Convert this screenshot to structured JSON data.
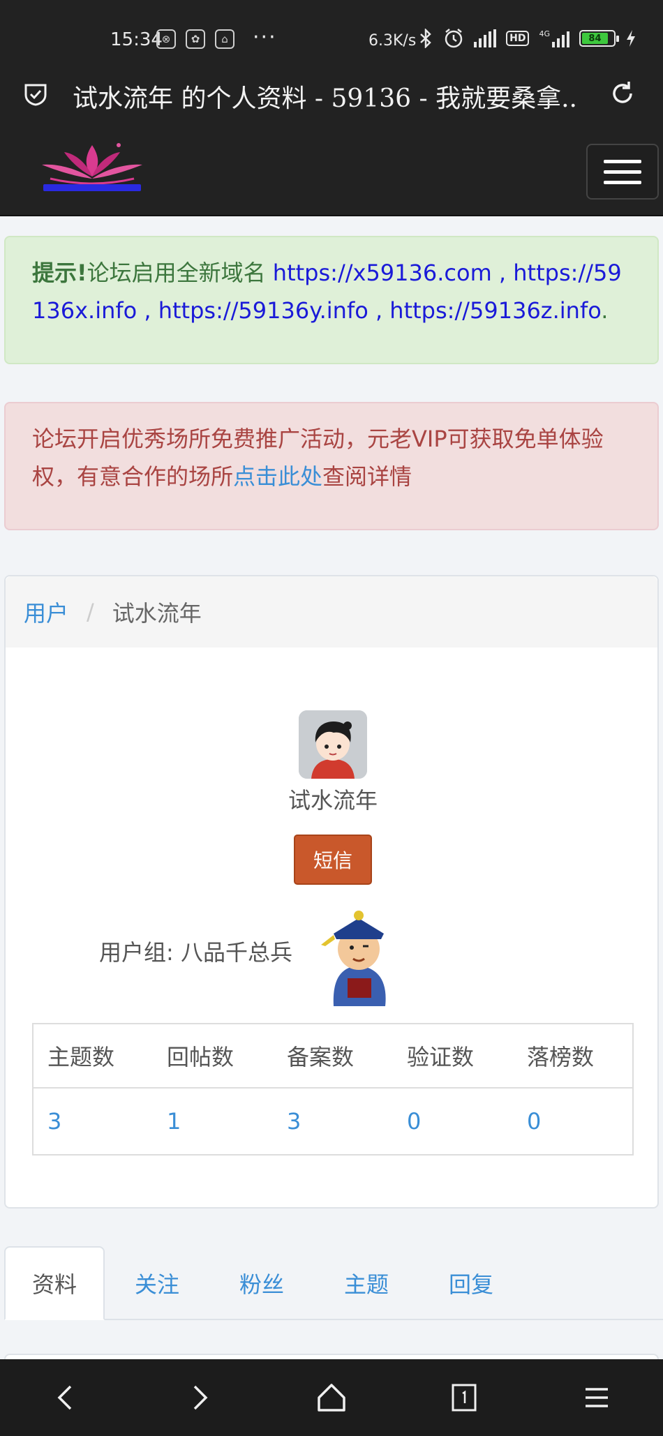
{
  "status_bar": {
    "time": "15:34",
    "speed": "6.3K/s",
    "network": "4G",
    "hd": "HD",
    "battery": "84"
  },
  "browser": {
    "page_title": "试水流年 的个人资料 - 59136 - 我就要桑拿..."
  },
  "alerts": {
    "notice_label": "提示!",
    "notice_text": "论坛启用全新域名 ",
    "notice_links": "https://x59136.com , https://59136x.info , https://59136y.info , https://59136z.info",
    "notice_end": ".",
    "promo_text": "论坛开启优秀场所免费推广活动，元老VIP可获取免单体验权，有意合作的场所",
    "promo_link": "点击此处",
    "promo_end": "查阅详情"
  },
  "breadcrumb": {
    "parent": "用户",
    "separator": "/",
    "current": "试水流年"
  },
  "profile": {
    "username": "试水流年",
    "message_button": "短信",
    "group_label": "用户组: 八品千总兵"
  },
  "stats": {
    "headers": [
      "主题数",
      "回帖数",
      "备案数",
      "验证数",
      "落榜数"
    ],
    "values": [
      "3",
      "1",
      "3",
      "0",
      "0"
    ]
  },
  "tabs": [
    "资料",
    "关注",
    "粉丝",
    "主题",
    "回复"
  ],
  "colors": {
    "link": "#3a8ed6",
    "success_bg": "#dff0d8",
    "danger_bg": "#f2dede",
    "button": "#c9582b"
  }
}
